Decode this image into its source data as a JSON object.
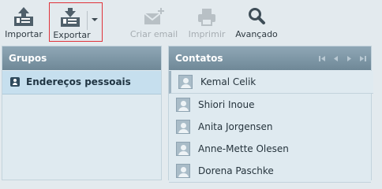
{
  "toolbar": {
    "import_label": "Importar",
    "export_label": "Exportar",
    "email_label": "Criar email",
    "print_label": "Imprimir",
    "advanced_label": "Avançado"
  },
  "groups": {
    "title": "Grupos",
    "items": [
      {
        "label": "Endereços pessoais"
      }
    ]
  },
  "contacts": {
    "title": "Contatos",
    "items": [
      {
        "name": "Kemal Celik"
      },
      {
        "name": "Shiori Inoue"
      },
      {
        "name": "Anita Jorgensen"
      },
      {
        "name": "Anne-Mette Olesen"
      },
      {
        "name": "Dorena Paschke"
      }
    ]
  },
  "colors": {
    "header": "#7b95a5",
    "selected_row": "#c6dfee",
    "highlight_border": "#e0333a"
  }
}
